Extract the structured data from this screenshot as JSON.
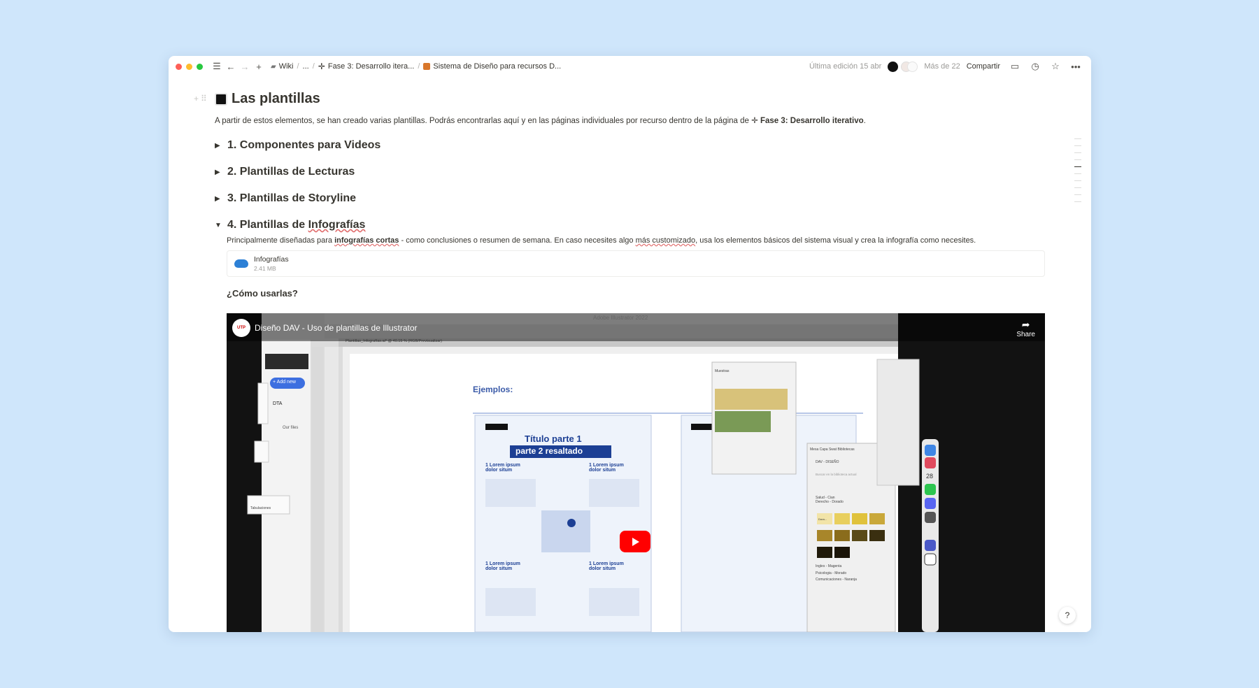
{
  "topbar": {
    "breadcrumbs": [
      "Wiki",
      "...",
      "Fase 3: Desarrollo itera...",
      "Sistema de Diseño para recursos D..."
    ],
    "last_edit": "Última edición 15 abr",
    "more_people": "Más de 22",
    "share": "Compartir"
  },
  "page": {
    "title": "Las plantillas",
    "intro_prefix": "A partir de estos elementos, se han creado varias plantillas. Podrás encontrarlas aquí y en las páginas individuales por recurso dentro de la página de",
    "intro_link": "Fase 3: Desarrollo iterativo",
    "intro_suffix": "."
  },
  "toggles": [
    {
      "label": "1. Componentes para Videos",
      "open": false
    },
    {
      "label": "2. Plantillas de Lecturas",
      "open": false
    },
    {
      "label": "3. Plantillas de Storyline",
      "open": false
    }
  ],
  "open_toggle": {
    "label_prefix": "4. Plantillas de",
    "label_word": "Infografías",
    "desc_prefix": "Principalmente diseñadas para",
    "desc_bold": "infografías cortas",
    "desc_mid": "- como conclusiones o resumen de semana. En caso necesites algo",
    "desc_link": "más customizado",
    "desc_suffix": ", usa los elementos básicos del sistema visual y crea la infografía como necesites.",
    "file": {
      "name": "Infografías",
      "size": "2.41 MB"
    },
    "subhead": "¿Cómo usarlas?"
  },
  "video": {
    "title": "Diseño DAV - Uso de plantillas de Illustrator",
    "share": "Share",
    "app_title": "Adobe Illustrator 2022",
    "doc_tab": "Plantillas_Infografías.ai* @ 40.15 % (RGB/Previsualizar)",
    "artboard_heading": "Ejemplos:",
    "card_title_1": "Título parte 1",
    "card_title_2": "parte 2 resaltado",
    "lorem_heading": "1 Lorem ipsum dolor situm",
    "add_new": "+ Add new",
    "dta": "DTA",
    "our_files": "Our files",
    "tabulaciones": "Tabulaciones",
    "muestras": "Muestras",
    "panel_tabs": "Mesa  Capa  Swat  Bibliotecas",
    "library_name": "DAV - DISEÑO",
    "library_search": "Buscar en la biblioteca actual",
    "library_groups": [
      "Salud - Cian",
      "Derecho - Dorado",
      "Ingles - Magenta",
      "Psicologia - Morado",
      "Comunicaciones - Naranja"
    ],
    "swatch_label": "Dora...",
    "calendar_day": "28"
  },
  "colors": {
    "background": "#cfe6fb",
    "accent_red": "#ff0000",
    "utp_blue": "#1c3f94"
  }
}
